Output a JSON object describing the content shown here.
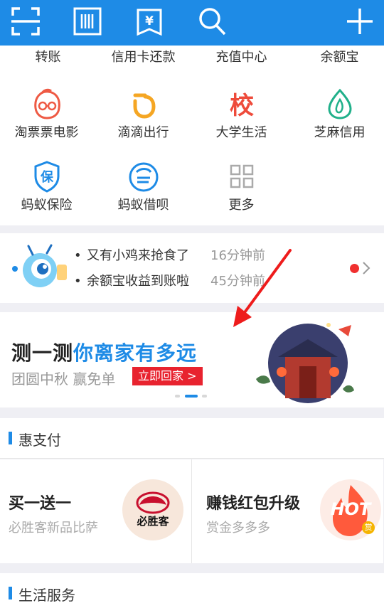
{
  "top_bar": {
    "icons": [
      "scan-icon",
      "barcode-icon",
      "bill-icon",
      "search-icon",
      "plus-icon"
    ],
    "bill_glyph": "¥"
  },
  "grid": {
    "row0": [
      "转账",
      "信用卡还款",
      "充值中心",
      "余额宝"
    ],
    "row1": [
      {
        "label": "淘票票电影",
        "icon": "movie-icon"
      },
      {
        "label": "滴滴出行",
        "icon": "didi-icon"
      },
      {
        "label": "大学生活",
        "icon": "campus-icon",
        "glyph": "校"
      },
      {
        "label": "芝麻信用",
        "icon": "sesame-credit-icon"
      }
    ],
    "row2": [
      {
        "label": "蚂蚁保险",
        "icon": "insurance-shield-icon",
        "glyph": "保"
      },
      {
        "label": "蚂蚁借呗",
        "icon": "jiebei-icon"
      },
      {
        "label": "更多",
        "icon": "more-grid-icon"
      }
    ]
  },
  "news": {
    "items": [
      {
        "text": "又有小鸡来抢食了",
        "time": "16分钟前"
      },
      {
        "text": "余额宝收益到账啦",
        "time": "45分钟前"
      }
    ],
    "bullet": "•"
  },
  "banner": {
    "title_plain": "测一测",
    "title_highlight": "你离家有多远",
    "subtitle": "团圆中秋 赢免单",
    "button": "立即回家 >"
  },
  "huizhifu": {
    "title": "惠支付",
    "cards": [
      {
        "title": "买一送一",
        "subtitle": "必胜客新品比萨",
        "logo_text": "必胜客"
      },
      {
        "title": "赚钱红包升级",
        "subtitle": "赏金多多多",
        "logo_text": "HOT",
        "badge": "赏"
      }
    ]
  },
  "life_service": {
    "title": "生活服务"
  },
  "colors": {
    "brand": "#1e8be6",
    "accent_red": "#e8232f",
    "bg": "#efeff4"
  }
}
